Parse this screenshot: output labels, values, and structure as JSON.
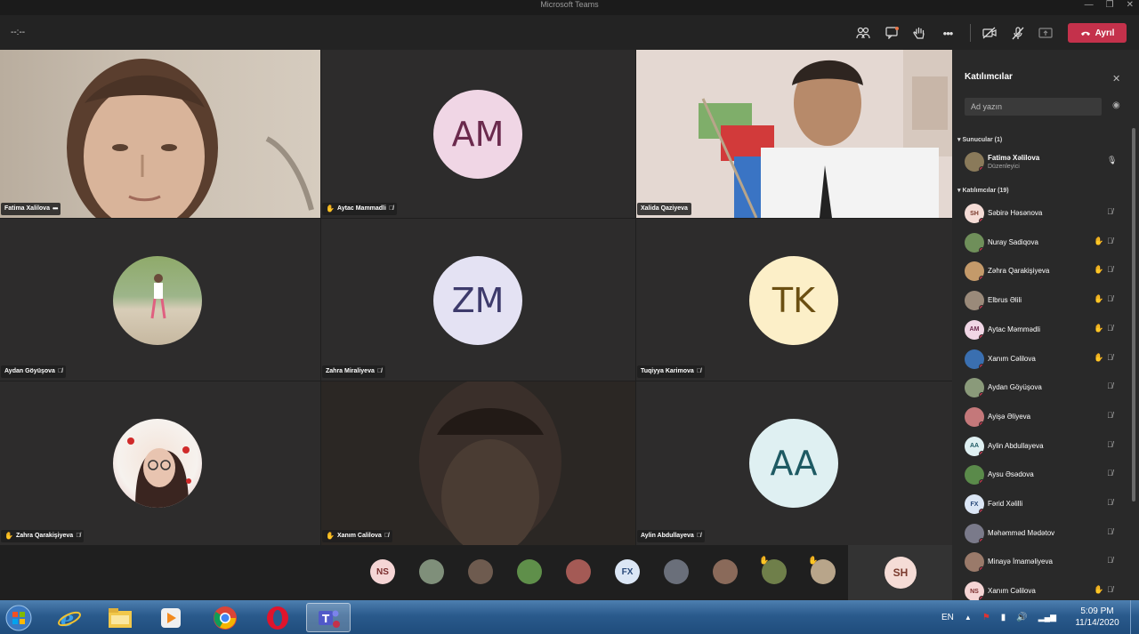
{
  "window": {
    "title": "Microsoft Teams",
    "controls": [
      "—",
      "❐",
      "✕"
    ]
  },
  "toolbar": {
    "timer": "--:--",
    "leave_label": "Ayrıl",
    "icons": [
      "people-icon",
      "chat-icon",
      "raise-hand-icon",
      "more-icon",
      "camera-off-icon",
      "mic-off-icon",
      "share-icon",
      "phone-icon"
    ]
  },
  "tiles": [
    {
      "name": "Fatima Xalilova",
      "kind": "video",
      "hand": false,
      "mic_off": false,
      "more": true
    },
    {
      "name": "Aytac Mammadli",
      "kind": "initials",
      "initials": "AM",
      "bg": "#f0d6e5",
      "fg": "#6b2a4d",
      "hand": true,
      "mic_off": true
    },
    {
      "name": "Xalida Qaziyeva",
      "kind": "video",
      "hand": false,
      "mic_off": false
    },
    {
      "name": "Aydan Göyüşova",
      "kind": "photo",
      "hand": false,
      "mic_off": true
    },
    {
      "name": "Zahra Miraliyeva",
      "kind": "initials",
      "initials": "ZM",
      "bg": "#e4e2f3",
      "fg": "#3d3a6b",
      "hand": false,
      "mic_off": true
    },
    {
      "name": "Tuqiyya Karimova",
      "kind": "initials",
      "initials": "TK",
      "bg": "#fcefc8",
      "fg": "#6b4f12",
      "hand": false,
      "mic_off": true
    },
    {
      "name": "Zahra Qarakişiyeva",
      "kind": "photo",
      "hand": true,
      "mic_off": true
    },
    {
      "name": "Xanım Calilova",
      "kind": "video",
      "hand": true,
      "mic_off": true
    },
    {
      "name": "Aylin Abdullayeva",
      "kind": "initials",
      "initials": "AA",
      "bg": "#dff0f2",
      "fg": "#1e5a63",
      "hand": false,
      "mic_off": true
    }
  ],
  "strip": {
    "avatars": [
      {
        "label": "NS",
        "bg": "#f5d5d5",
        "fg": "#7a2d2d"
      },
      {
        "label": "",
        "bg": "#7f8f7a"
      },
      {
        "label": "",
        "bg": "#6e5b4f"
      },
      {
        "label": "",
        "bg": "#5f8f4a"
      },
      {
        "label": "",
        "bg": "#a45a55"
      },
      {
        "label": "FX",
        "bg": "#dbe6f5",
        "fg": "#2a4a7a"
      },
      {
        "label": "",
        "bg": "#6a6f7a"
      },
      {
        "label": "",
        "bg": "#8a6a5a"
      },
      {
        "label": "",
        "bg": "#6f7f4a",
        "hand": true
      },
      {
        "label": "",
        "bg": "#b8a58a",
        "hand": true
      }
    ],
    "self": {
      "label": "SH",
      "bg": "#f5dcd6",
      "fg": "#7a3a2d"
    }
  },
  "panel": {
    "title": "Katılımcılar",
    "search_placeholder": "Ad yazın",
    "presenters_header": "Sunucular (1)",
    "attendees_header": "Katılımcılar (19)",
    "presenter": {
      "name": "Fatimə Xəlilova",
      "role": "Düzenleyici",
      "bg": "#8a7a5a"
    },
    "attendees": [
      {
        "name": "Səbirə Həsənova",
        "initials": "SH",
        "bg": "#f5dcd6",
        "fg": "#7a3a2d",
        "hand": false
      },
      {
        "name": "Nuray Sadiqova",
        "initials": "",
        "bg": "#6f8f5a",
        "hand": true
      },
      {
        "name": "Zəhra Qarakişiyeva",
        "initials": "",
        "bg": "#c49a6a",
        "hand": true
      },
      {
        "name": "Elbrus Əlili",
        "initials": "",
        "bg": "#9a8a7a",
        "hand": true
      },
      {
        "name": "Aytac Məmmədli",
        "initials": "AM",
        "bg": "#f0d6e5",
        "fg": "#6b2a4d",
        "hand": true
      },
      {
        "name": "Xanım Cəlilova",
        "initials": "",
        "bg": "#3a6fb0",
        "hand": true
      },
      {
        "name": "Aydan Göyüşova",
        "initials": "",
        "bg": "#8a9a7a",
        "hand": false
      },
      {
        "name": "Ayişə Əliyeva",
        "initials": "",
        "bg": "#c4787a",
        "hand": false
      },
      {
        "name": "Aylin Abdullayeva",
        "initials": "AA",
        "bg": "#dff0f2",
        "fg": "#1e5a63",
        "hand": false
      },
      {
        "name": "Aysu Əsədova",
        "initials": "",
        "bg": "#5a8a4a",
        "hand": false
      },
      {
        "name": "Fərid Xəlilli",
        "initials": "FX",
        "bg": "#dbe6f5",
        "fg": "#2a4a7a",
        "hand": false
      },
      {
        "name": "Məhəmməd Mədətov",
        "initials": "",
        "bg": "#7a7a8a",
        "hand": false
      },
      {
        "name": "Minayə İmaməliyeva",
        "initials": "",
        "bg": "#9a7a6a",
        "hand": false
      },
      {
        "name": "Xanım Cəlilova",
        "initials": "NS",
        "bg": "#f5d5d5",
        "fg": "#7a2d2d",
        "hand": true
      }
    ]
  },
  "taskbar": {
    "apps": [
      "start-orb-icon",
      "internet-explorer-icon",
      "file-explorer-icon",
      "media-player-icon",
      "chrome-icon",
      "opera-icon",
      "teams-icon"
    ],
    "language": "EN",
    "time": "5:09 PM",
    "date": "11/14/2020"
  }
}
